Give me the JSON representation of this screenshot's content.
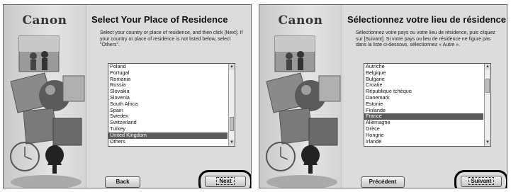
{
  "en": {
    "logo": "Canon",
    "title": "Select Your Place of Residence",
    "instructions": "Select your country or place of residence, and then click [Next]. If your country or place of residence is not listed below, select \"Others\".",
    "list_items": [
      "Poland",
      "Portugal",
      "Romania",
      "Russia",
      "Slovakia",
      "Slovenia",
      "South Africa",
      "Spain",
      "Sweden",
      "Switzerland",
      "Turkey",
      "United Kingdom",
      "Others"
    ],
    "selected_item": "United Kingdom",
    "scroll_position": 0.85,
    "back_label": "Back",
    "next_label": "Next"
  },
  "fr": {
    "logo": "Canon",
    "title": "Sélectionnez votre lieu de résidence",
    "instructions": "Sélectionnez votre pays ou votre lieu de résidence, puis cliquez sur [Suivant]. Si votre pays ou lieu de résidence ne figure pas dans la liste ci-dessous, sélectionnez « Autre ».",
    "list_items": [
      "Autriche",
      "Belgique",
      "Bulgarie",
      "Croatie",
      "République tchèque",
      "Danemark",
      "Estonie",
      "Finlande",
      "France",
      "Allemagne",
      "Grèce",
      "Hongrie",
      "Irlande"
    ],
    "selected_item": "France",
    "scroll_position": 0.15,
    "back_label": "Précédent",
    "next_label": "Suivant"
  },
  "colors": {
    "selection": "#5a5a5a",
    "highlight_ring": "#000000"
  }
}
